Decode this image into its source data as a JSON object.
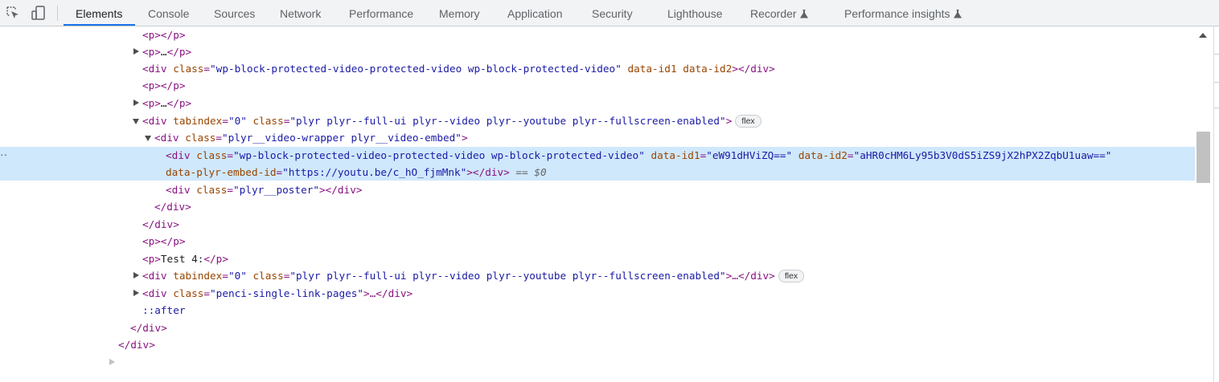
{
  "tabs": [
    {
      "label": "Elements"
    },
    {
      "label": "Console"
    },
    {
      "label": "Sources"
    },
    {
      "label": "Network"
    },
    {
      "label": "Performance"
    },
    {
      "label": "Memory"
    },
    {
      "label": "Application"
    },
    {
      "label": "Security"
    },
    {
      "label": "Lighthouse"
    },
    {
      "label": "Recorder"
    },
    {
      "label": "Performance insights"
    }
  ],
  "icons": {
    "inspect": "inspect-element-icon",
    "device": "device-toolbar-icon",
    "experimental": "flask-icon"
  },
  "active_tab": "Elements",
  "selection_color": "#cfe8fc",
  "accent_color": "#1a73e8",
  "tree": {
    "l1": {
      "open": "<p>",
      "close": "</p>"
    },
    "l2": {
      "open": "<p>",
      "ellipsis": "…",
      "close": "</p>"
    },
    "l3": {
      "open": "<div",
      "class_attr": "class",
      "class_val": "\"wp-block-protected-video-protected-video wp-block-protected-video\"",
      "attr1": "data-id1",
      "attr2": "data-id2",
      "end": "></div>"
    },
    "l4": {
      "open": "<p>",
      "close": "</p>"
    },
    "l5": {
      "open": "<p>",
      "ellipsis": "…",
      "close": "</p>"
    },
    "l6": {
      "open": "<div",
      "tabindex_attr": "tabindex",
      "tabindex_val": "\"0\"",
      "class_attr": "class",
      "class_val": "\"plyr plyr--full-ui plyr--video plyr--youtube plyr--fullscreen-enabled\"",
      "end": ">",
      "badge": "flex"
    },
    "l7": {
      "open": "<div",
      "class_attr": "class",
      "class_val": "\"plyr__video-wrapper plyr__video-embed\"",
      "end": ">"
    },
    "l8": {
      "open": "<div",
      "class_attr": "class",
      "class_val": "\"wp-block-protected-video-protected-video wp-block-protected-video\"",
      "id1_attr": "data-id1",
      "id1_val": "\"eW91dHViZQ==\"",
      "id2_attr": "data-id2",
      "id2_val": "\"aHR0cHM6Ly95b3V0dS5iZS9jX2hPX2ZqbU1uaw==\""
    },
    "l9": {
      "embed_attr": "data-plyr-embed-id",
      "embed_val": "\"https://youtu.be/c_hO_fjmMnk\"",
      "end": "></div>",
      "console_ref": " == $0"
    },
    "l10": {
      "open": "<div",
      "class_attr": "class",
      "class_val": "\"plyr__poster\"",
      "end": "></div>"
    },
    "l11": {
      "close": "</div>"
    },
    "l12": {
      "close": "</div>"
    },
    "l13": {
      "open": "<p>",
      "close": "</p>"
    },
    "l14": {
      "open": "<p>",
      "text": "Test 4:",
      "close": "</p>"
    },
    "l15": {
      "open": "<div",
      "tabindex_attr": "tabindex",
      "tabindex_val": "\"0\"",
      "class_attr": "class",
      "class_val": "\"plyr plyr--full-ui plyr--video plyr--youtube plyr--fullscreen-enabled\"",
      "end": ">…</div>",
      "badge": "flex"
    },
    "l16": {
      "open": "<div",
      "class_attr": "class",
      "class_val": "\"penci-single-link-pages\"",
      "end": ">…</div>"
    },
    "l17": {
      "pseudo": "::after"
    },
    "l18": {
      "close": "</div>"
    },
    "l19": {
      "close": "</div>"
    }
  }
}
